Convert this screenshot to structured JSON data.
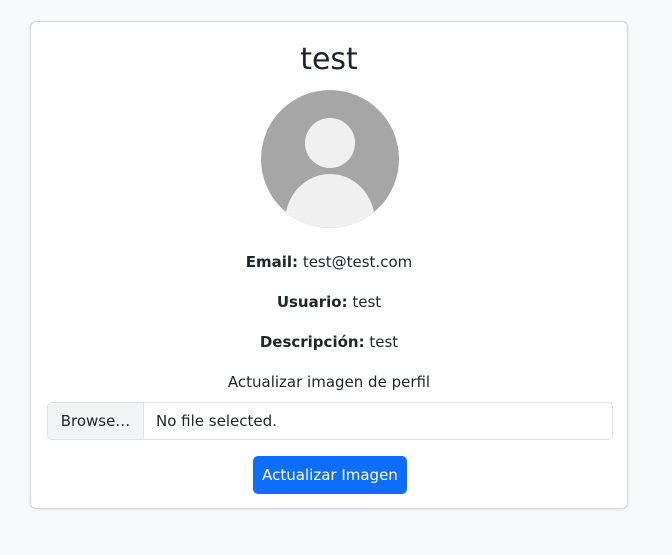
{
  "profile": {
    "username_title": "test",
    "avatar_icon": "default-user-avatar-icon",
    "email_label": "Email:",
    "email_value": "test@test.com",
    "user_label": "Usuario:",
    "user_value": "test",
    "description_label": "Descripción:",
    "description_value": "test"
  },
  "upload": {
    "label": "Actualizar imagen de perfil",
    "browse_label": "Browse…",
    "file_status": "No file selected.",
    "submit_label": "Actualizar Imagen"
  },
  "colors": {
    "primary": "#0d6efd",
    "avatar_bg": "#a6a6a6",
    "avatar_fg": "#f0f0f0"
  }
}
